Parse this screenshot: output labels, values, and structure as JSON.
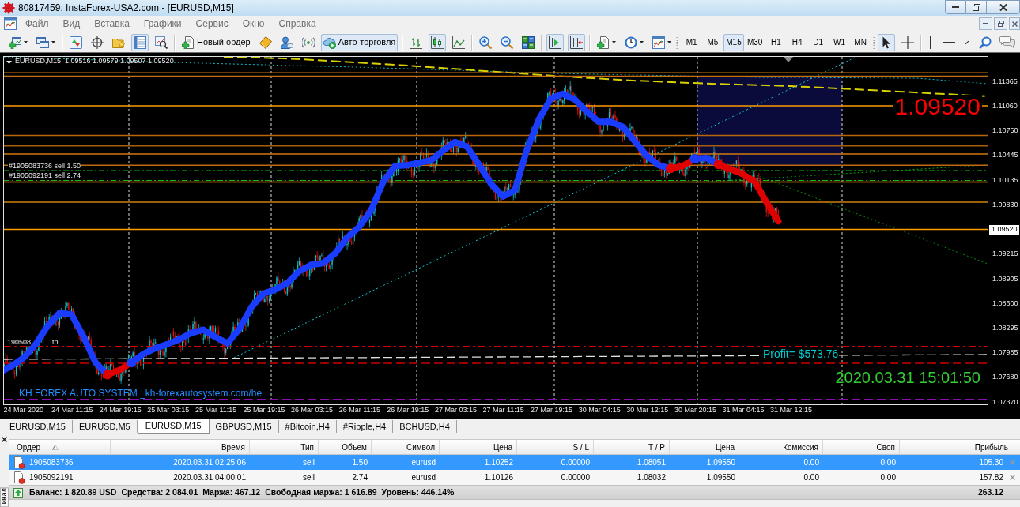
{
  "window": {
    "title": "80817459: InstaForex-USA2.com - [EURUSD,M15]"
  },
  "menu": [
    "Файл",
    "Вид",
    "Вставка",
    "Графики",
    "Сервис",
    "Окно",
    "Справка"
  ],
  "toolbar": {
    "groups": [
      [
        {
          "kind": "new-chart"
        },
        {
          "kind": "profiles"
        }
      ],
      [
        {
          "kind": "market-watch",
          "on": false
        },
        {
          "kind": "data-window",
          "on": false
        },
        {
          "kind": "navigator",
          "on": false
        },
        {
          "kind": "terminal",
          "on": true
        },
        {
          "kind": "tester",
          "on": false
        }
      ],
      [
        {
          "kind": "new-order",
          "label": "Новый ордер"
        },
        {
          "kind": "metaeditor"
        },
        {
          "kind": "community"
        },
        {
          "kind": "signals"
        },
        {
          "kind": "auto-trading",
          "label": "Авто-торговля",
          "on": true
        }
      ],
      [
        {
          "kind": "bar-chart",
          "selected": false
        },
        {
          "kind": "candlestick-chart",
          "selected": true
        },
        {
          "kind": "line-chart",
          "selected": false
        }
      ],
      [
        {
          "kind": "zoom-in"
        },
        {
          "kind": "zoom-out"
        },
        {
          "kind": "tile-windows"
        }
      ],
      [
        {
          "kind": "chart-shift",
          "on": true
        },
        {
          "kind": "auto-scroll",
          "on": true
        }
      ],
      [
        {
          "kind": "indicators"
        },
        {
          "kind": "periods"
        },
        {
          "kind": "templates"
        }
      ]
    ],
    "timeframes": [
      {
        "label": "M1",
        "selected": false
      },
      {
        "label": "M5",
        "selected": false
      },
      {
        "label": "M15",
        "selected": true
      },
      {
        "label": "M30",
        "selected": false
      },
      {
        "label": "H1",
        "selected": false
      },
      {
        "label": "H4",
        "selected": false
      },
      {
        "label": "D1",
        "selected": false
      },
      {
        "label": "W1",
        "selected": false
      },
      {
        "label": "MN",
        "selected": false
      }
    ],
    "tools": [
      [
        {
          "kind": "cursor",
          "selected": true
        },
        {
          "kind": "crosshair",
          "selected": false
        }
      ],
      [
        {
          "kind": "vertical-line"
        },
        {
          "kind": "horizontal-line"
        },
        {
          "kind": "trendline"
        },
        {
          "kind": "search"
        },
        {
          "kind": "chat"
        }
      ]
    ]
  },
  "chart": {
    "legend_symbol": "EURUSD,M15",
    "legend_prices": "1.09516 1.09579 1.09507 1.09520",
    "order_labels": [
      "#1905083736 sell 1.50",
      "#1905092191 sell 2.74"
    ],
    "hidden_label_parts": [
      "190508",
      "tp"
    ],
    "price_display": "1.09520",
    "profit": "Profit= $573.76",
    "server_time": "2020.03.31 15:01:50",
    "signature": "KH FOREX AUTO SYSTEM _kh-forexautosystem.com/he",
    "current_price": "1.09520",
    "chart_data": {
      "type": "line",
      "categories": [
        null,
        null,
        "24 Mar 2020",
        null,
        null,
        null,
        "24 Mar 11:15",
        null,
        null,
        null,
        "24 Mar 19:15",
        null,
        null,
        null,
        "25 Mar 03:15",
        null,
        null,
        null,
        "25 Mar 11:15",
        null,
        null,
        null,
        "25 Mar 19:15",
        null,
        null,
        null,
        "26 Mar 03:15",
        null,
        null,
        null,
        "26 Mar 11:15",
        null,
        null,
        null,
        "26 Mar 19:15",
        null,
        null,
        null,
        "27 Mar 03:15",
        null,
        null,
        null,
        "27 Mar 11:15",
        null,
        null,
        null,
        "27 Mar 19:15",
        null,
        null,
        null,
        "30 Mar 04:15",
        null,
        null,
        null,
        "30 Mar 12:15",
        null,
        null,
        null,
        "30 Mar 20:15",
        null,
        null,
        null,
        "31 Mar 04:15",
        null,
        null,
        null,
        "31 Mar 12:15",
        null,
        null,
        null,
        null,
        null,
        null,
        null,
        null,
        null,
        null,
        null,
        null,
        null,
        null,
        null,
        null
      ],
      "series": [
        {
          "color": "#1a3cff",
          "values": [
            1.0774,
            1.0782,
            1.0792,
            1.0809,
            1.0832,
            1.0848,
            1.0846,
            1.0818,
            1.0786,
            1.0771,
            null,
            1.0786,
            1.0797,
            1.0804,
            1.0809,
            1.0815,
            1.0823,
            1.0827,
            1.0818,
            1.081,
            1.0828,
            1.0855,
            1.0872,
            1.0877,
            1.0885,
            1.09,
            1.0908,
            1.091,
            1.0922,
            1.0942,
            1.0955,
            1.0976,
            1.1011,
            1.1031,
            1.1032,
            1.1035,
            1.1038,
            1.105,
            1.1061,
            1.1055,
            1.1033,
            1.1009,
            1.0993,
            1.1001,
            1.1051,
            1.1089,
            1.1115,
            1.1121,
            1.1114,
            1.1099,
            1.1086,
            1.1086,
            1.108,
            1.1062,
            1.1044,
            1.1032,
            1.1028,
            null,
            1.104,
            1.1041,
            1.1033,
            null,
            null,
            null,
            null,
            null,
            null,
            null,
            null,
            null,
            null,
            null,
            null,
            null,
            null,
            null,
            null,
            null,
            null,
            null,
            null,
            null,
            null
          ]
        },
        {
          "color": "#e00000",
          "values": [
            null,
            null,
            null,
            null,
            null,
            null,
            null,
            null,
            null,
            1.0771,
            1.0777,
            1.0786,
            null,
            null,
            null,
            null,
            null,
            null,
            null,
            null,
            null,
            null,
            null,
            null,
            null,
            null,
            null,
            null,
            null,
            null,
            null,
            null,
            null,
            null,
            null,
            null,
            null,
            null,
            null,
            null,
            null,
            null,
            null,
            null,
            null,
            null,
            null,
            null,
            null,
            null,
            null,
            null,
            null,
            null,
            null,
            null,
            1.1028,
            1.1031,
            1.104,
            null,
            1.1033,
            1.1027,
            1.1021,
            1.1012,
            1.0986,
            1.0962,
            null,
            null,
            null,
            null,
            null,
            null,
            null,
            null,
            null,
            null,
            null,
            null,
            null,
            null,
            null,
            null,
            null
          ]
        }
      ],
      "ylim": [
        1.07331,
        1.1168
      ],
      "yticks": [
        {
          "value": 1.11365,
          "label": "1.11365"
        },
        {
          "value": 1.1106,
          "label": "1.11060"
        },
        {
          "value": 1.1075,
          "label": "1.10750"
        },
        {
          "value": 1.10445,
          "label": "1.10445"
        },
        {
          "value": 1.10135,
          "label": "1.10135"
        },
        {
          "value": 1.0983,
          "label": "1.09830"
        },
        {
          "value": 1.09215,
          "label": "1.09215"
        },
        {
          "value": 1.08905,
          "label": "1.08905"
        },
        {
          "value": 1.086,
          "label": "1.08600"
        },
        {
          "value": 1.08295,
          "label": "1.08295"
        },
        {
          "value": 1.07985,
          "label": "1.07985"
        },
        {
          "value": 1.0768,
          "label": "1.07680"
        },
        {
          "value": 1.0737,
          "label": "1.07370"
        }
      ],
      "ref_lines": [
        {
          "axis": "y",
          "value": 1.1147,
          "color": "#d07a10"
        },
        {
          "axis": "y",
          "value": 1.1143,
          "color": "#c87010"
        },
        {
          "axis": "y",
          "value": 1.1106,
          "color": "#ff9a00"
        },
        {
          "axis": "y",
          "value": 1.1069,
          "color": "#b8650c"
        },
        {
          "axis": "y",
          "value": 1.1056,
          "color": "#a85c0c"
        },
        {
          "axis": "y",
          "value": 1.1046,
          "color": "#d07a10"
        },
        {
          "axis": "y",
          "value": 1.1032,
          "color": "#c06a10"
        },
        {
          "axis": "y",
          "value": 1.1011,
          "color": "#ff9a00"
        },
        {
          "axis": "y",
          "value": 1.0986,
          "color": "#d08010"
        },
        {
          "axis": "y",
          "value": 1.0952,
          "color": "#ff9a00"
        }
      ]
    }
  },
  "chart_tabs": [
    {
      "label": "EURUSD,M15",
      "selected": false
    },
    {
      "label": "EURUSD,M5",
      "selected": false
    },
    {
      "label": "EURUSD,M15",
      "selected": true
    },
    {
      "label": "GBPUSD,M15",
      "selected": false
    },
    {
      "label": "#Bitcoin,H4",
      "selected": false
    },
    {
      "label": "#Ripple,H4",
      "selected": false
    },
    {
      "label": "BCHUSD,H4",
      "selected": false
    }
  ],
  "terminal": {
    "side_tab": "инал",
    "columns": [
      {
        "label": "Ордер",
        "sorted": true
      },
      {
        "label": "Время",
        "sorted": false
      },
      {
        "label": "Тип",
        "sorted": false
      },
      {
        "label": "Объем",
        "sorted": false
      },
      {
        "label": "Символ",
        "sorted": false
      },
      {
        "label": "Цена",
        "sorted": false
      },
      {
        "label": "S / L",
        "sorted": false
      },
      {
        "label": "T / P",
        "sorted": false
      },
      {
        "label": "Цена",
        "sorted": false
      },
      {
        "label": "Комиссия",
        "sorted": false
      },
      {
        "label": "Своп",
        "sorted": false
      },
      {
        "label": "Прибыль",
        "sorted": false
      }
    ],
    "rows": [
      {
        "selected": true,
        "cells": [
          "1905083736",
          "2020.03.31 02:25:06",
          "sell",
          "1.50",
          "eurusd",
          "1.10252",
          "0.00000",
          "1.08051",
          "1.09550",
          "0.00",
          "0.00",
          "105.30"
        ]
      },
      {
        "selected": false,
        "cells": [
          "1905092191",
          "2020.03.31 04:00:01",
          "sell",
          "2.74",
          "eurusd",
          "1.10126",
          "0.00000",
          "1.08032",
          "1.09550",
          "0.00",
          "0.00",
          "157.82"
        ]
      }
    ],
    "summary": [
      "Баланс: 1 820.89 USD",
      "Средства: 2 084.01",
      "Маржа: 467.12",
      "Свободная маржа: 1 616.89",
      "Уровень: 446.14%"
    ],
    "summary_total": "263.12"
  }
}
